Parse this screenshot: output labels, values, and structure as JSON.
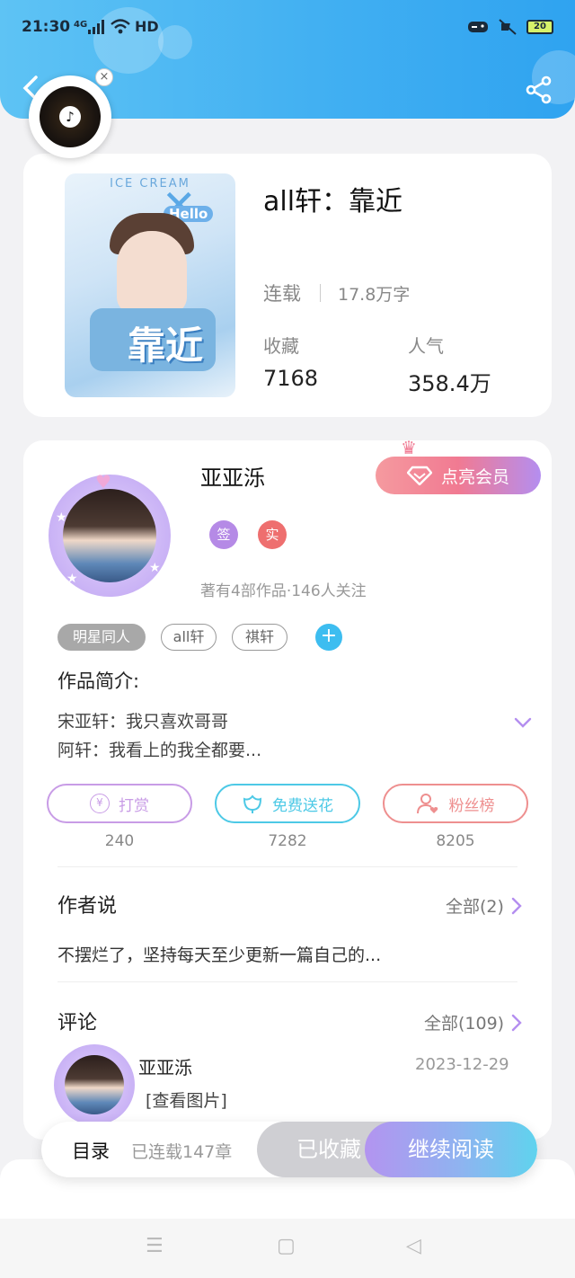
{
  "status_bar": {
    "time": "21:30",
    "network": "4G",
    "wifi_label": "HD",
    "battery": "20"
  },
  "header": {
    "back_icon": "chevron-left-icon",
    "share_icon": "share-icon",
    "accent_color": "#42b0f2"
  },
  "music_widget": {
    "icon": "music-note-icon",
    "close_label": "×"
  },
  "book": {
    "cover_top_text": "ICE CREAM",
    "cover_title_text": "靠近",
    "cover_hello": "Hello",
    "title": "all轩：靠近",
    "status": "连载",
    "word_count": "17.8万字",
    "favorites_label": "收藏",
    "favorites_value": "7168",
    "popularity_label": "人气",
    "popularity_value": "358.4万"
  },
  "author": {
    "name": "亚亚泺",
    "vip_button": "点亮会员",
    "badge_signed": "签",
    "badge_verified": "实",
    "meta": "著有4部作品·146人关注",
    "tags": [
      "明星同人",
      "all轩",
      "祺轩"
    ],
    "add_tag": "+",
    "intro_title": "作品简介:",
    "intro_lines": [
      "宋亚轩：我只喜欢哥哥",
      "阿轩：我看上的我全都要..."
    ]
  },
  "actions": [
    {
      "label": "打赏",
      "count": "240",
      "icon": "yen-coin-icon",
      "color": "#c89ce6"
    },
    {
      "label": "免费送花",
      "count": "7282",
      "icon": "flower-icon",
      "color": "#4dc9e6"
    },
    {
      "label": "粉丝榜",
      "count": "8205",
      "icon": "user-heart-icon",
      "color": "#ee8f8f"
    }
  ],
  "author_says": {
    "title": "作者说",
    "all_link": "全部(2)",
    "text": "不摆烂了，坚持每天至少更新一篇自己的..."
  },
  "comments": {
    "title": "评论",
    "all_link": "全部(109)",
    "items": [
      {
        "user": "亚亚泺",
        "date": "2023-12-29",
        "text": "[查看图片]"
      }
    ]
  },
  "read_bar": {
    "toc": "目录",
    "chapters": "已连载147章",
    "saved": "已收藏",
    "continue": "继续阅读"
  },
  "nav_bar": {
    "menu": "☰",
    "home": "▢",
    "back": "◁"
  }
}
